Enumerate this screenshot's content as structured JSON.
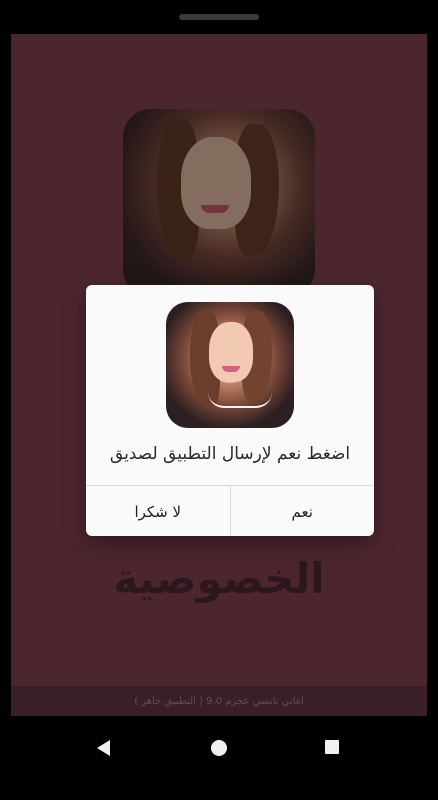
{
  "app": {
    "background_title": "الخصوصية",
    "footer_text": "اغاني نانسي عجرم 9.0 ( التطبيق جاهز )"
  },
  "dialog": {
    "message": "اضغط نعم لإرسال التطبيق لصديق",
    "buttons": {
      "no": "لا شكرا",
      "yes": "نعم"
    }
  },
  "icons": {
    "back": "back-icon",
    "home": "home-icon",
    "recents": "recents-icon"
  },
  "colors": {
    "background": "#5e2f3d",
    "dialog": "#fafafa"
  }
}
